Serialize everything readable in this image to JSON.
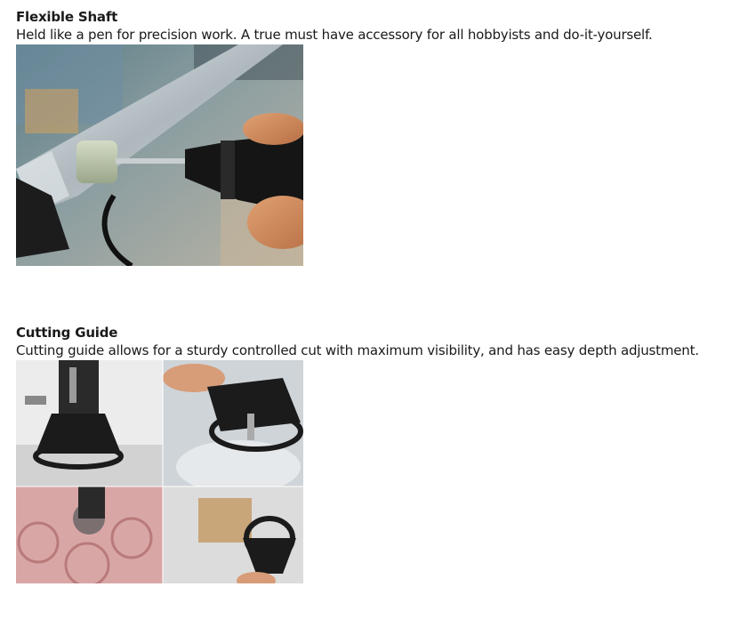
{
  "sections": [
    {
      "title": "Flexible Shaft",
      "description": "Held like a pen for precision work. A true must have accessory for all hobbyists and do-it-yourself.",
      "image": "flexible-shaft-photo"
    },
    {
      "title": "Cutting Guide",
      "description": "Cutting guide allows for a sturdy controlled cut with maximum visibility, and has easy depth adjustment.",
      "image": "cutting-guide-photo-grid"
    }
  ],
  "colors": {
    "text": "#1a1a1a",
    "tool_black": "#151515",
    "stone_green": "#b9c3a8",
    "pink_foam": "#d9a6a6"
  }
}
